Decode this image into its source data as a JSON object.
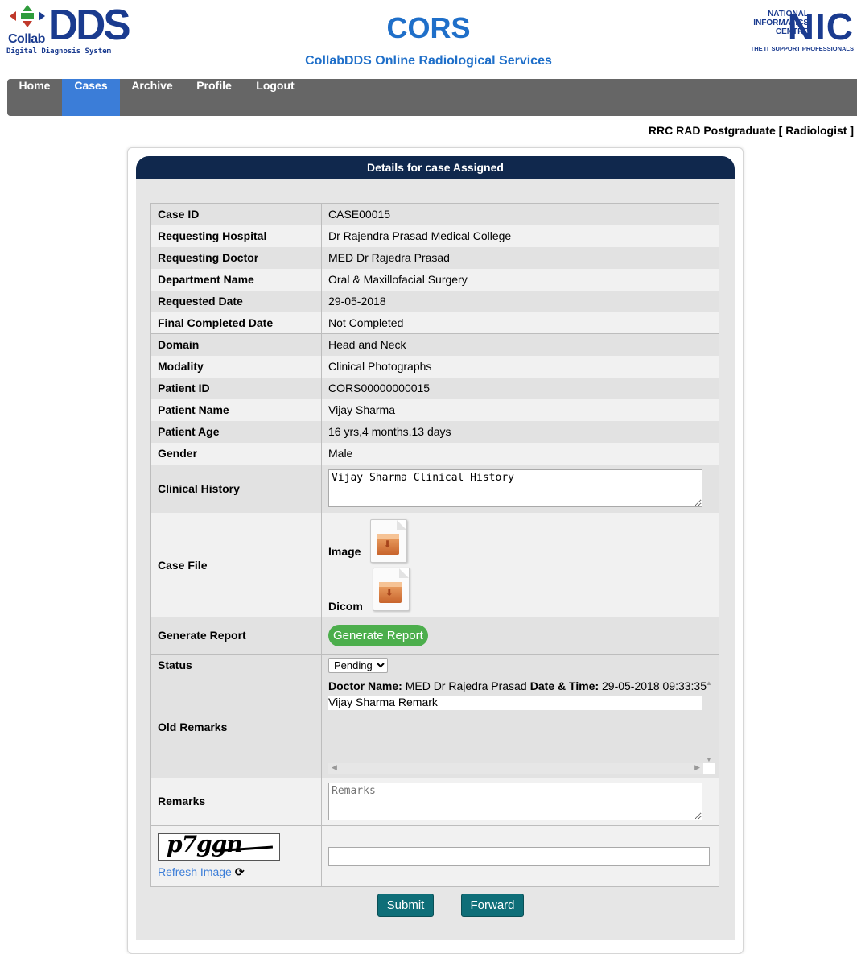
{
  "header": {
    "logo_collab": "Collab",
    "logo_dds": "DDS",
    "logo_sub": "Digital Diagnosis System",
    "title": "CORS",
    "subtitle": "CollabDDS Online Radiological Services",
    "nic_lines": [
      "NATIONAL",
      "INFORMATICS",
      "CENTRE"
    ],
    "nic_big": "NIC",
    "nic_tag": "THE IT SUPPORT PROFESSIONALS"
  },
  "nav": {
    "items": [
      {
        "label": "Home"
      },
      {
        "label": "Cases"
      },
      {
        "label": "Archive"
      },
      {
        "label": "Profile"
      },
      {
        "label": "Logout"
      }
    ],
    "active": "Cases"
  },
  "user_role": "RRC RAD Postgraduate [ Radiologist ]",
  "card": {
    "title": "Details for case Assigned",
    "rows": [
      {
        "label": "Case ID",
        "value": "CASE00015"
      },
      {
        "label": "Requesting Hospital",
        "value": "Dr Rajendra Prasad Medical College"
      },
      {
        "label": "Requesting Doctor",
        "value": "MED Dr Rajedra Prasad"
      },
      {
        "label": "Department Name",
        "value": "Oral & Maxillofacial Surgery"
      },
      {
        "label": "Requested Date",
        "value": "29-05-2018"
      },
      {
        "label": "Final Completed Date",
        "value": "Not Completed"
      },
      {
        "label": "Domain",
        "value": "Head and Neck"
      },
      {
        "label": "Modality",
        "value": "Clinical Photographs"
      },
      {
        "label": "Patient ID",
        "value": "CORS00000000015"
      },
      {
        "label": "Patient Name",
        "value": "Vijay Sharma"
      },
      {
        "label": "Patient Age",
        "value": "16 yrs,4 months,13 days"
      },
      {
        "label": "Gender",
        "value": "Male"
      }
    ],
    "clinical_history": {
      "label": "Clinical History",
      "value": "Vijay Sharma Clinical History"
    },
    "case_file": {
      "label": "Case File",
      "image_label": "Image",
      "dicom_label": "Dicom"
    },
    "generate_report": {
      "label": "Generate Report",
      "button": "Generate Report"
    },
    "status": {
      "label": "Status",
      "selected": "Pending"
    },
    "old_remarks": {
      "label": "Old Remarks",
      "doctor_label": "Doctor Name:",
      "doctor_value": "MED Dr Rajedra Prasad",
      "datetime_label": "Date & Time:",
      "datetime_value": "29-05-2018 09:33:35",
      "text": "Vijay Sharma Remark"
    },
    "remarks": {
      "label": "Remarks",
      "placeholder": "Remarks"
    },
    "captcha": {
      "text": "p7ggn",
      "refresh": "Refresh Image",
      "input_value": ""
    },
    "buttons": {
      "submit": "Submit",
      "forward": "Forward"
    }
  }
}
